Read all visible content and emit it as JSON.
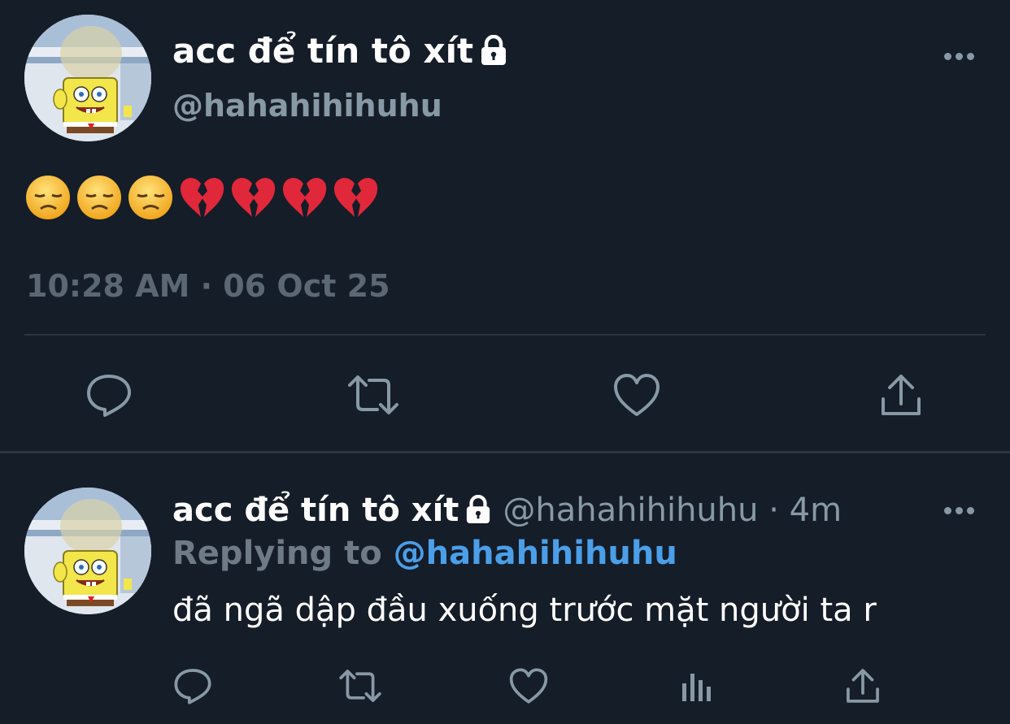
{
  "tweet": {
    "display_name": "acc để tín tô xít",
    "handle": "@hahahihihuhu",
    "emojis": [
      "disappointed-face",
      "disappointed-face",
      "disappointed-face",
      "broken-heart",
      "broken-heart",
      "broken-heart",
      "broken-heart"
    ],
    "timestamp": "10:28 AM · 06 Oct 25",
    "actions": [
      "reply-icon",
      "retweet-icon",
      "like-icon",
      "share-icon"
    ]
  },
  "reply": {
    "display_name": "acc để tín tô xít",
    "handle_time": "@hahahihihuhu · 4m",
    "replying_prefix": "Replying to",
    "replying_mention": "@hahahihihuhu",
    "text": "đã ngã dập đầu xuống trước mặt người ta r",
    "actions": [
      "reply-icon",
      "retweet-icon",
      "like-icon",
      "analytics-icon",
      "share-icon"
    ]
  },
  "colors": {
    "background": "#151d29",
    "secondary_text": "#8899a6",
    "link": "#4a9fe8",
    "divider": "#2b3641"
  }
}
